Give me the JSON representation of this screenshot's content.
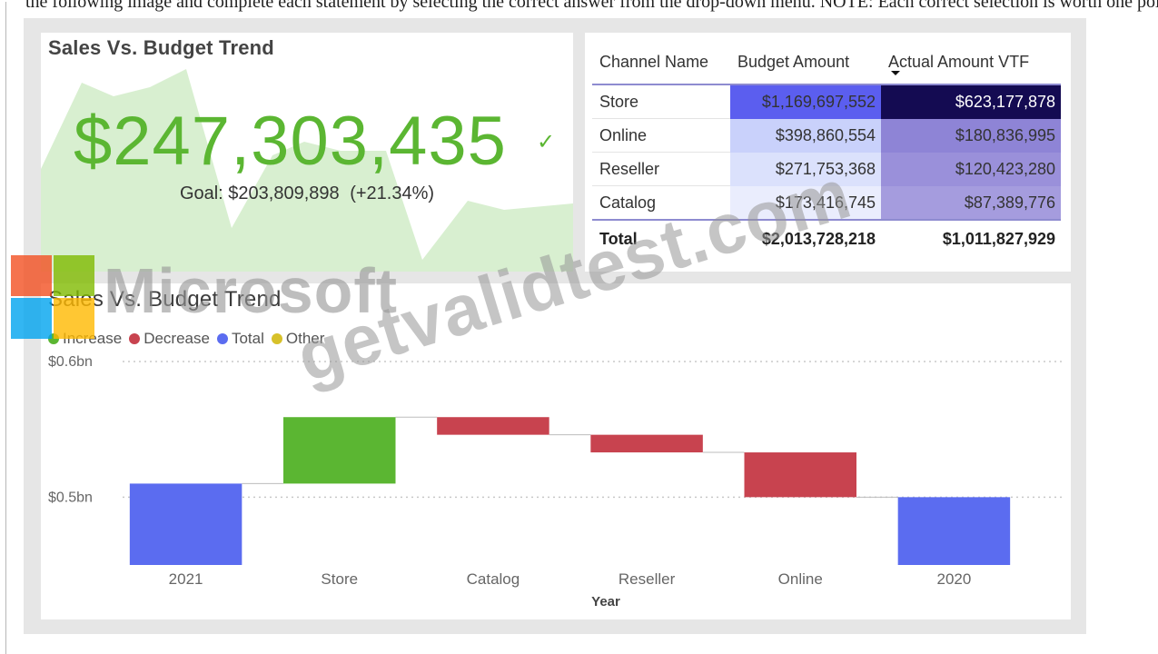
{
  "top_text": "the following image and complete each statement by selecting the correct answer from the drop-down menu. NOTE: Each correct selection is worth one point.",
  "kpi": {
    "title": "Sales Vs. Budget Trend",
    "value": "$247,303,435",
    "check_icon": "checkmark-icon",
    "goal_label": "Goal: $203,809,898",
    "goal_pct": "(+21.34%)",
    "value_color": "#5bb632",
    "area_color": "#d8efd0"
  },
  "table": {
    "headers": [
      "Channel Name",
      "Budget Amount",
      "Actual Amount VTF"
    ],
    "sort_icon": "sort-descending-icon",
    "rows": [
      {
        "name": "Store",
        "budget": "$1,169,697,552",
        "actual": "$623,177,878",
        "budget_bg": "#5b5eef",
        "actual_bg": "#140b52",
        "actual_fg": "#ffffff"
      },
      {
        "name": "Online",
        "budget": "$398,860,554",
        "actual": "$180,836,995",
        "budget_bg": "#c9d1fb",
        "actual_bg": "#8e84d6",
        "actual_fg": "#333333"
      },
      {
        "name": "Reseller",
        "budget": "$271,753,368",
        "actual": "$120,423,280",
        "budget_bg": "#dbe1fc",
        "actual_bg": "#9a90da",
        "actual_fg": "#333333"
      },
      {
        "name": "Catalog",
        "budget": "$173,416,745",
        "actual": "$87,389,776",
        "budget_bg": "#eaedfd",
        "actual_bg": "#a59cde",
        "actual_fg": "#333333"
      }
    ],
    "total": {
      "name": "Total",
      "budget": "$2,013,728,218",
      "actual": "$1,011,827,929"
    }
  },
  "chart_data": {
    "type": "waterfall",
    "title": "Sales Vs. Budget Trend",
    "xlabel": "Year",
    "ylabel": "",
    "categories": [
      "2021",
      "Store",
      "Catalog",
      "Reseller",
      "Online",
      "2020"
    ],
    "series": [
      {
        "name": "Increase",
        "color": "#5bb632"
      },
      {
        "name": "Decrease",
        "color": "#c8434f"
      },
      {
        "name": "Total",
        "color": "#5b6cf0"
      },
      {
        "name": "Other",
        "color": "#d7c12a"
      }
    ],
    "bars": [
      {
        "category": "2021",
        "start": 0.45,
        "end": 0.51,
        "kind": "Total"
      },
      {
        "category": "Store",
        "start": 0.51,
        "end": 0.559,
        "kind": "Increase"
      },
      {
        "category": "Catalog",
        "start": 0.559,
        "end": 0.546,
        "kind": "Decrease"
      },
      {
        "category": "Reseller",
        "start": 0.546,
        "end": 0.533,
        "kind": "Decrease"
      },
      {
        "category": "Online",
        "start": 0.533,
        "end": 0.5,
        "kind": "Decrease"
      },
      {
        "category": "2020",
        "start": 0.45,
        "end": 0.5,
        "kind": "Total"
      }
    ],
    "y_ticks": [
      {
        "value": 0.5,
        "label": "$0.5bn"
      },
      {
        "value": 0.6,
        "label": "$0.6bn"
      }
    ],
    "ylim": [
      0.45,
      0.6
    ],
    "grid": true,
    "legend_position": "top-left"
  },
  "overlays": {
    "logo_text": "Microsoft",
    "logo_colors": [
      "#f25022",
      "#7fba00",
      "#00a4ef",
      "#ffb900"
    ],
    "watermark": "getvalidtest.com"
  }
}
